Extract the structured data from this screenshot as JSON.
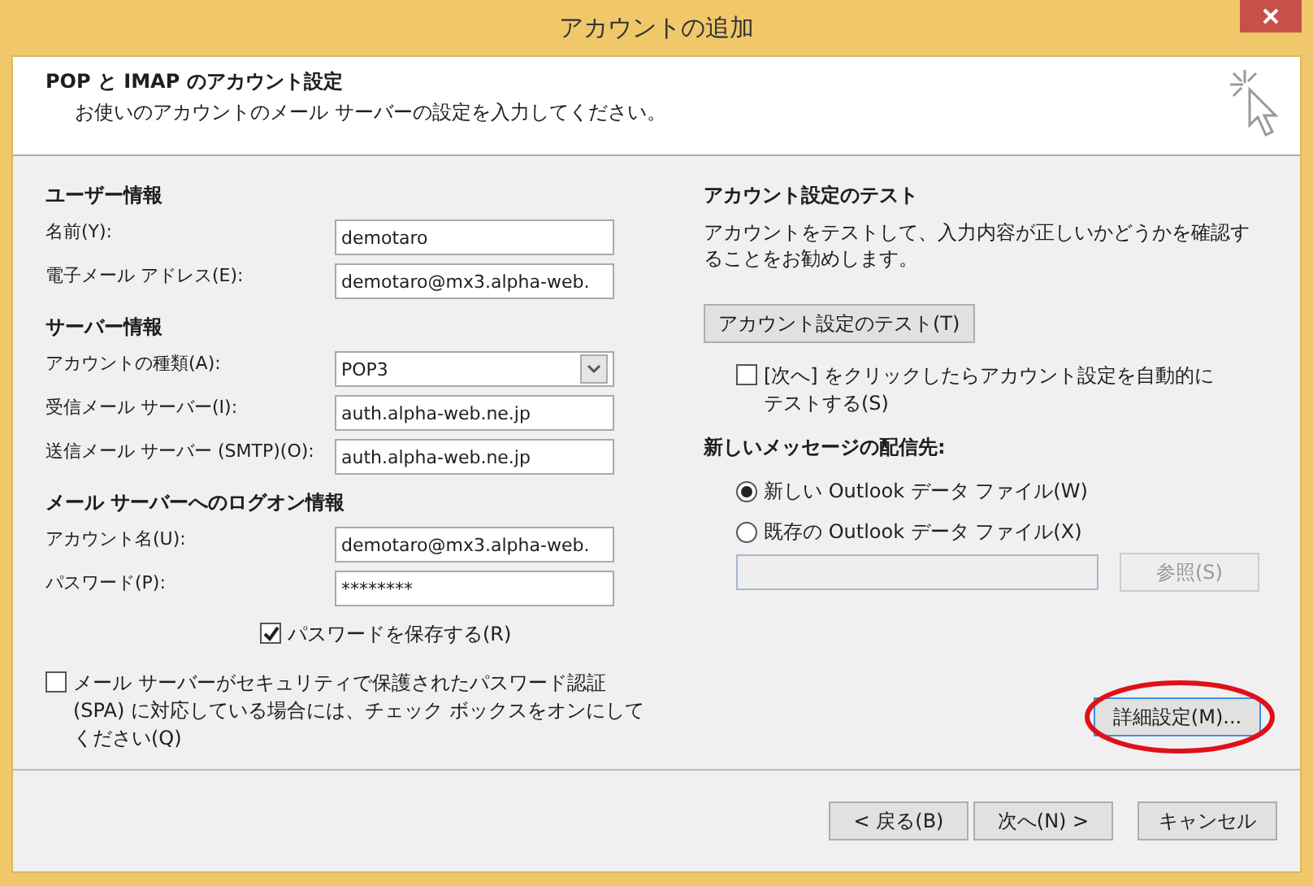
{
  "window": {
    "title": "アカウントの追加"
  },
  "header": {
    "title": "POP と IMAP のアカウント設定",
    "subtitle": "お使いのアカウントのメール サーバーの設定を入力してください。"
  },
  "left": {
    "sections": [
      {
        "heading": "ユーザー情報",
        "fields": [
          {
            "kind": "text",
            "label": "名前(Y):",
            "value": "demotaro"
          },
          {
            "kind": "text",
            "label": "電子メール アドレス(E):",
            "value": "demotaro@mx3.alpha-web."
          }
        ]
      },
      {
        "heading": "サーバー情報",
        "fields": [
          {
            "kind": "select",
            "label": "アカウントの種類(A):",
            "value": "POP3"
          },
          {
            "kind": "text",
            "label": "受信メール サーバー(I):",
            "value": "auth.alpha-web.ne.jp"
          },
          {
            "kind": "text",
            "label": "送信メール サーバー (SMTP)(O):",
            "value": "auth.alpha-web.ne.jp"
          }
        ]
      },
      {
        "heading": "メール サーバーへのログオン情報",
        "fields": [
          {
            "kind": "text",
            "label": "アカウント名(U):",
            "value": "demotaro@mx3.alpha-web."
          },
          {
            "kind": "password",
            "label": "パスワード(P):",
            "value": "********"
          }
        ]
      }
    ],
    "save_password": {
      "label": "パスワードを保存する(R)",
      "checked": true
    },
    "spa": {
      "label": "メール サーバーがセキュリティで保護されたパスワード認証 (SPA) に対応している場合には、チェック ボックスをオンにしてください(Q)",
      "checked": false
    }
  },
  "right": {
    "heading": "アカウント設定のテスト",
    "description": "アカウントをテストして、入力内容が正しいかどうかを確認することをお勧めします。",
    "test_button": "アカウント設定のテスト(T)",
    "auto_test": {
      "label": "[次へ] をクリックしたらアカウント設定を自動的にテストする(S)",
      "checked": false
    },
    "delivery_heading": "新しいメッセージの配信先:",
    "delivery_options": [
      {
        "label": "新しい Outlook データ ファイル(W)",
        "selected": true
      },
      {
        "label": "既存の Outlook データ ファイル(X)",
        "selected": false
      }
    ],
    "browse_button": {
      "label": "参照(S)",
      "disabled": true
    },
    "advanced_button": {
      "label": "詳細設定(M)...",
      "focused": true
    }
  },
  "footer": {
    "buttons": [
      {
        "label": "< 戻る(B)"
      },
      {
        "label": "次へ(N) >"
      },
      {
        "label": "キャンセル"
      }
    ]
  }
}
